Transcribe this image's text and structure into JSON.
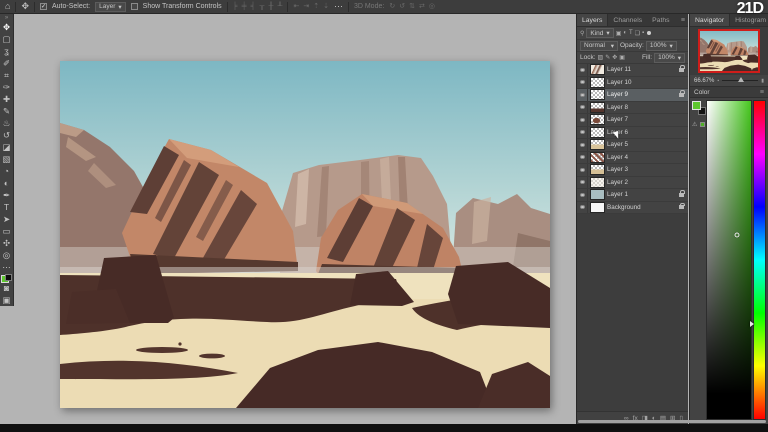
{
  "logo": "21D",
  "optionsBar": {
    "home_icon": "⌂",
    "active_tool_icon": "✥",
    "auto_select_checked": "✓",
    "auto_select_label": "Auto-Select:",
    "target_value": "Layer",
    "dropdown_caret": "▾",
    "transform_label": "Show Transform Controls",
    "align_icons": [
      "╞",
      "╪",
      "╡",
      "╥",
      "╫",
      "╨"
    ],
    "distribute_icons": [
      "⇤",
      "⇥",
      "⇡",
      "⇣"
    ],
    "more_label": "⋯",
    "mode_label": "3D Mode:",
    "mode_icons": [
      "↻",
      "↺",
      "⇅",
      "⇄",
      "◎"
    ]
  },
  "tools": {
    "grip": "»",
    "items": [
      {
        "name": "move-tool",
        "glyph": "✥"
      },
      {
        "name": "marquee-tool",
        "glyph": "▢"
      },
      {
        "name": "lasso-tool",
        "glyph": "ʓ"
      },
      {
        "name": "quick-selection-tool",
        "glyph": "✐"
      },
      {
        "name": "crop-tool",
        "glyph": "⌗"
      },
      {
        "name": "eyedropper-tool",
        "glyph": "✑"
      },
      {
        "name": "healing-brush-tool",
        "glyph": "✚"
      },
      {
        "name": "brush-tool",
        "glyph": "✎"
      },
      {
        "name": "clone-stamp-tool",
        "glyph": "♨"
      },
      {
        "name": "history-brush-tool",
        "glyph": "↺"
      },
      {
        "name": "eraser-tool",
        "glyph": "◪"
      },
      {
        "name": "gradient-tool",
        "glyph": "▧"
      },
      {
        "name": "blur-tool",
        "glyph": "◔"
      },
      {
        "name": "dodge-tool",
        "glyph": "◐"
      },
      {
        "name": "pen-tool",
        "glyph": "✒"
      },
      {
        "name": "type-tool",
        "glyph": "T"
      },
      {
        "name": "path-selection-tool",
        "glyph": "➤"
      },
      {
        "name": "shape-tool",
        "glyph": "▭"
      },
      {
        "name": "hand-tool",
        "glyph": "✣"
      },
      {
        "name": "zoom-tool",
        "glyph": "◎"
      }
    ],
    "more": "⋯",
    "quick_mask": "◙",
    "screen_mode": "▣"
  },
  "layersPanel": {
    "tabs": [
      "Layers",
      "Channels",
      "Paths"
    ],
    "menu_icon": "≡",
    "search_icon": "⚲",
    "kind_label": "Kind",
    "caret": "▾",
    "filter_icons": [
      "▣",
      "◐",
      "T",
      "❏",
      "▪"
    ],
    "blend_value": "Normal",
    "opacity_label": "Opacity:",
    "opacity_value": "100%",
    "lock_label": "Lock:",
    "lock_icons": [
      "▨",
      "✎",
      "✥",
      "▣"
    ],
    "fill_label": "Fill:",
    "fill_value": "100%",
    "items": [
      {
        "name": "Layer 11",
        "locked": true
      },
      {
        "name": "Layer 10",
        "locked": false
      },
      {
        "name": "Layer 9",
        "selected": true,
        "locked": true
      },
      {
        "name": "Layer 8",
        "locked": false
      },
      {
        "name": "Layer 7",
        "locked": false
      },
      {
        "name": "Layer 6",
        "locked": false
      },
      {
        "name": "Layer 5",
        "locked": false
      },
      {
        "name": "Layer 4",
        "locked": false
      },
      {
        "name": "Layer 3",
        "locked": false
      },
      {
        "name": "Layer 2",
        "locked": false
      },
      {
        "name": "Layer 1",
        "locked": true
      },
      {
        "name": "Background",
        "locked": true
      }
    ],
    "footer_icons": [
      "∞",
      "fx",
      "◨",
      "◐",
      "▤",
      "⊞",
      "▯"
    ]
  },
  "navigator": {
    "tabs": [
      "Navigator",
      "Histogram"
    ],
    "menu_icon": "≡",
    "zoom_value": "66.67%",
    "slider_small": "▪",
    "slider_large": "▮"
  },
  "colorPanel": {
    "title": "Color",
    "menu_icon": "≡",
    "warning_icon": "⚠",
    "foreground_hex": "#5ec72e",
    "background_hex": "#141414",
    "hue_hex": "#46c81e"
  },
  "palette": {
    "ui_panel": "#434343",
    "ui_border": "#282828",
    "pasteboard": "#b4b4b4",
    "selected_row": "#5a5f62",
    "navigator_border": "#cf1d1a",
    "sky_top": "#7db7c3",
    "sky_bottom": "#e0ede6",
    "rock_lit": "#c28768",
    "rock_shadow": "#5e3f36",
    "mesa_far": "#94766b",
    "plateau": "#b69a8b",
    "sand": "#ecdcb4",
    "foreground_rock": "#472b26",
    "logo_color": "#ffffff"
  }
}
